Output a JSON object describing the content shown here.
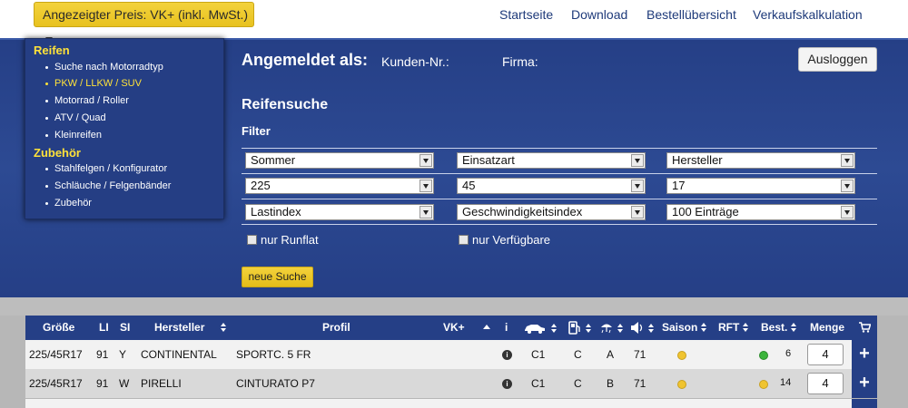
{
  "topbar": {
    "price_label": "Angezeigter Preis: VK+ (inkl. MwSt.)",
    "nav": [
      "Startseite",
      "Download",
      "Bestellübersicht",
      "Verkaufskalkulation"
    ]
  },
  "menu": {
    "group1": "Reifen",
    "group1_items": [
      "Suche nach Motorradtyp",
      "PKW / LLKW / SUV",
      "Motorrad / Roller",
      "ATV / Quad",
      "Kleinreifen"
    ],
    "group2": "Zubehör",
    "group2_items": [
      "Stahlfelgen / Konfigurator",
      "Schläuche / Felgenbänder",
      "Zubehör"
    ]
  },
  "account": {
    "logged_in": "Angemeldet als:",
    "customer_no": "Kunden-Nr.:",
    "company": "Firma:",
    "logout": "Ausloggen"
  },
  "search": {
    "title": "Reifensuche",
    "filter": "Filter",
    "selects": [
      [
        "Sommer",
        "Einsatzart",
        "Hersteller"
      ],
      [
        "225",
        "45",
        "17"
      ],
      [
        "Lastindex",
        "Geschwindigkeitsindex",
        "100 Einträge"
      ]
    ],
    "runflat": "nur Runflat",
    "available": "nur Verfügbare",
    "button": "neue Suche"
  },
  "table": {
    "headers": {
      "size": "Größe",
      "li": "LI",
      "si": "SI",
      "manufacturer": "Hersteller",
      "profile": "Profil",
      "vk": "VK+",
      "info": "i",
      "season": "Saison",
      "rft": "RFT",
      "stock": "Best.",
      "qty": "Menge"
    },
    "rows": [
      {
        "size": "225/45R17",
        "li": "91",
        "si": "Y",
        "manufacturer": "CONTINENTAL",
        "profile": "SPORTC. 5 FR",
        "fuel": "C1",
        "wet": "C",
        "noise_class": "A",
        "noise": "71",
        "season_color": "#f0c430",
        "stock_color": "#3cb43c",
        "stock": "6",
        "qty": "4"
      },
      {
        "size": "225/45R17",
        "li": "91",
        "si": "W",
        "manufacturer": "PIRELLI",
        "profile": "CINTURATO P7",
        "fuel": "C1",
        "wet": "C",
        "noise_class": "B",
        "noise": "71",
        "season_color": "#f0c430",
        "stock_color": "#f0c430",
        "stock": "14",
        "qty": "4"
      }
    ]
  }
}
